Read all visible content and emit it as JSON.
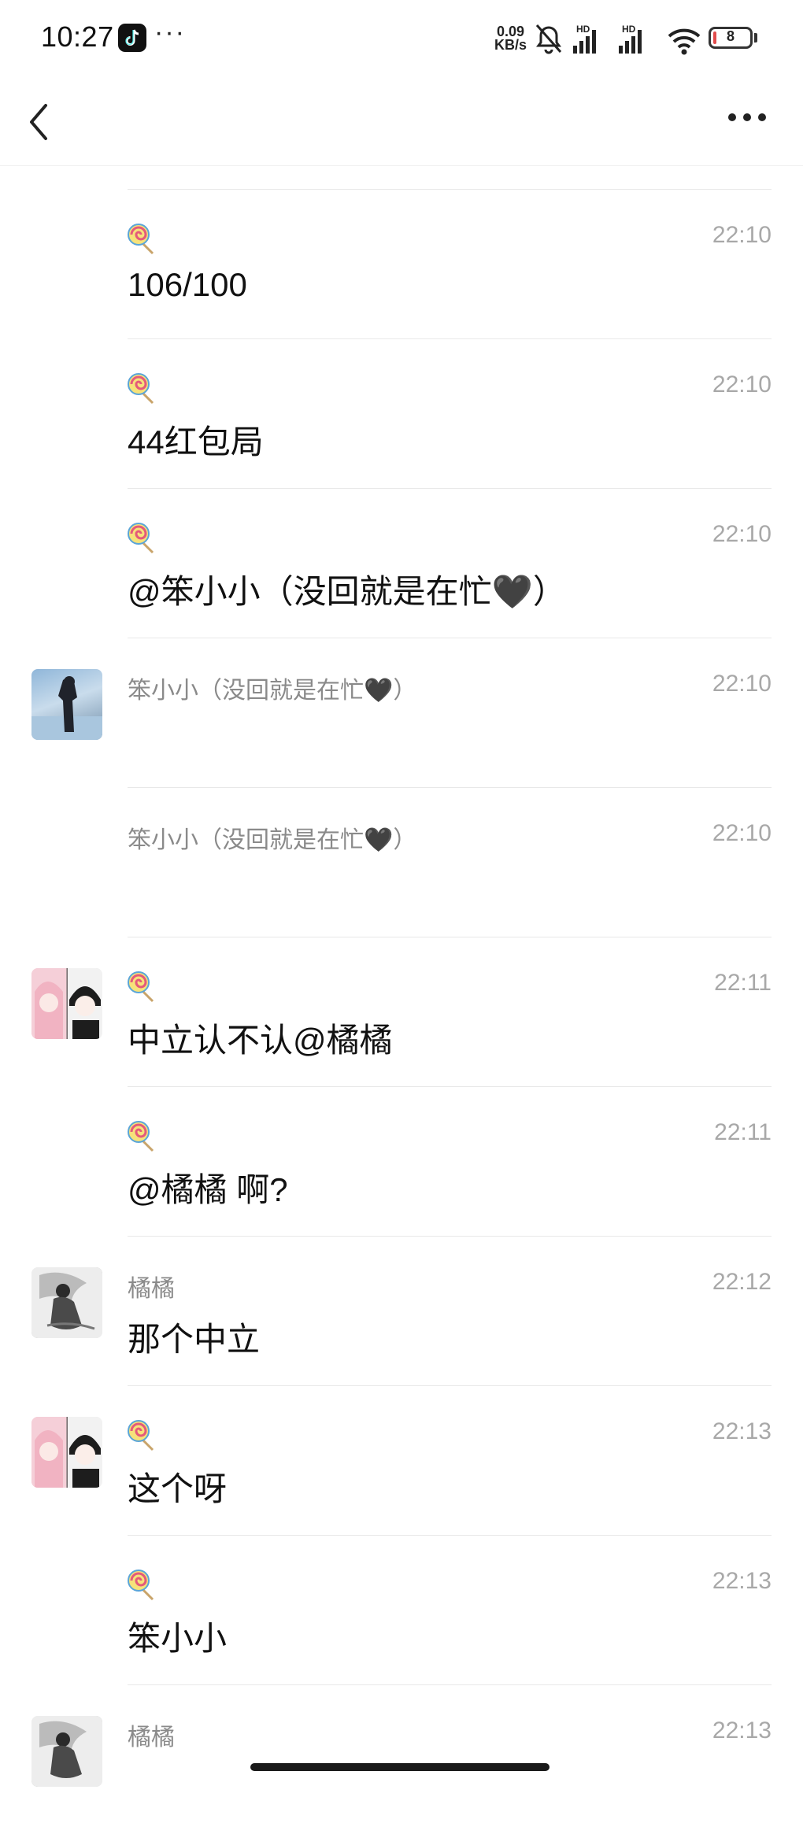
{
  "status_bar": {
    "time": "10:27",
    "dots": "···",
    "net_speed_value": "0.09",
    "net_speed_unit": "KB/s",
    "hd_label_1": "HD",
    "hd_label_2": "HD",
    "battery_level": "8"
  },
  "colors": {
    "timestamp": "#a8a8a8",
    "sender": "#8a8a8a",
    "divider": "#e8e8e8",
    "text": "#111111"
  },
  "messages": [
    {
      "avatar": "none",
      "sender": "",
      "sender_icon": "lollipop-icon",
      "time": "22:10",
      "text": "106/100"
    },
    {
      "avatar": "none",
      "sender": "",
      "sender_icon": "lollipop-icon",
      "time": "22:10",
      "text": "44红包局"
    },
    {
      "avatar": "none",
      "sender": "",
      "sender_icon": "lollipop-icon",
      "time": "22:10",
      "text": "@笨小小（没回就是在忙🖤）"
    },
    {
      "avatar": "sky",
      "sender": "笨小小（没回就是在忙🖤）",
      "sender_icon": "",
      "time": "22:10",
      "text": ""
    },
    {
      "avatar": "none",
      "sender": "笨小小（没回就是在忙🖤）",
      "sender_icon": "",
      "time": "22:10",
      "text": ""
    },
    {
      "avatar": "couple",
      "sender": "",
      "sender_icon": "lollipop-icon",
      "time": "22:11",
      "text": "中立认不认@橘橘"
    },
    {
      "avatar": "none",
      "sender": "",
      "sender_icon": "lollipop-icon",
      "time": "22:11",
      "text": "@橘橘 啊?"
    },
    {
      "avatar": "ink",
      "sender": "橘橘",
      "sender_icon": "",
      "time": "22:12",
      "text": "那个中立"
    },
    {
      "avatar": "couple",
      "sender": "",
      "sender_icon": "lollipop-icon",
      "time": "22:13",
      "text": "这个呀"
    },
    {
      "avatar": "none",
      "sender": "",
      "sender_icon": "lollipop-icon",
      "time": "22:13",
      "text": "笨小小"
    },
    {
      "avatar": "ink",
      "sender": "橘橘",
      "sender_icon": "",
      "time": "22:13",
      "text": ""
    }
  ]
}
